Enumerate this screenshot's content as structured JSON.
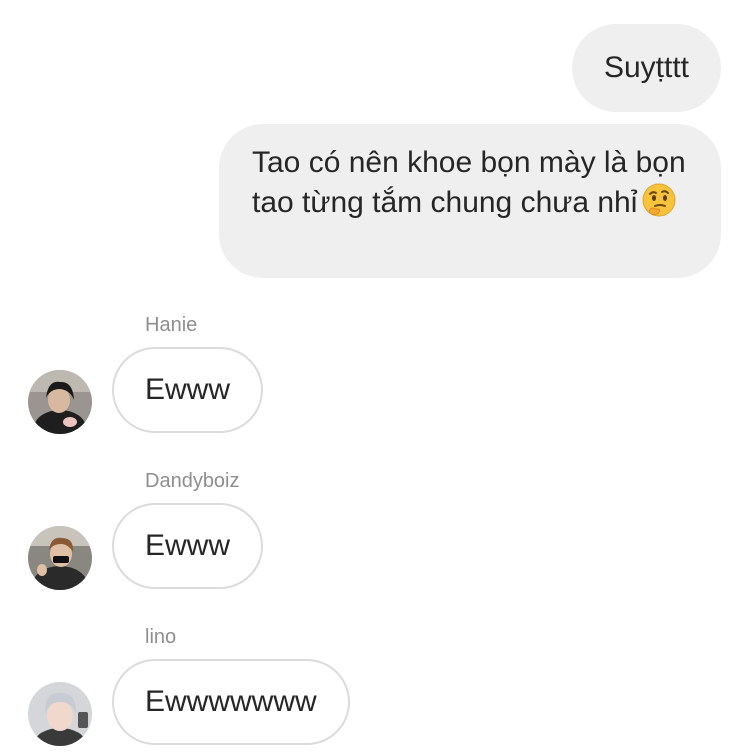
{
  "outgoing": [
    {
      "text": "Suyṭttt"
    },
    {
      "text": "Tao có nên khoe bọn mày là bọn tao từng tắm chung chưa nhỉ",
      "emoji": "thinking-face-emoji"
    }
  ],
  "incoming": [
    {
      "sender": "Hanie",
      "text": "Ewww",
      "avatar": "avatar-hanie"
    },
    {
      "sender": "Dandyboiz",
      "text": "Ewww",
      "avatar": "avatar-dandyboiz"
    },
    {
      "sender": "lino",
      "text": "Ewwwwwww",
      "avatar": "avatar-lino"
    }
  ],
  "colors": {
    "outgoing_bubble": "#efefef",
    "incoming_border": "#dbdbdb",
    "text": "#262626",
    "sender_name": "#8e8e8e"
  }
}
